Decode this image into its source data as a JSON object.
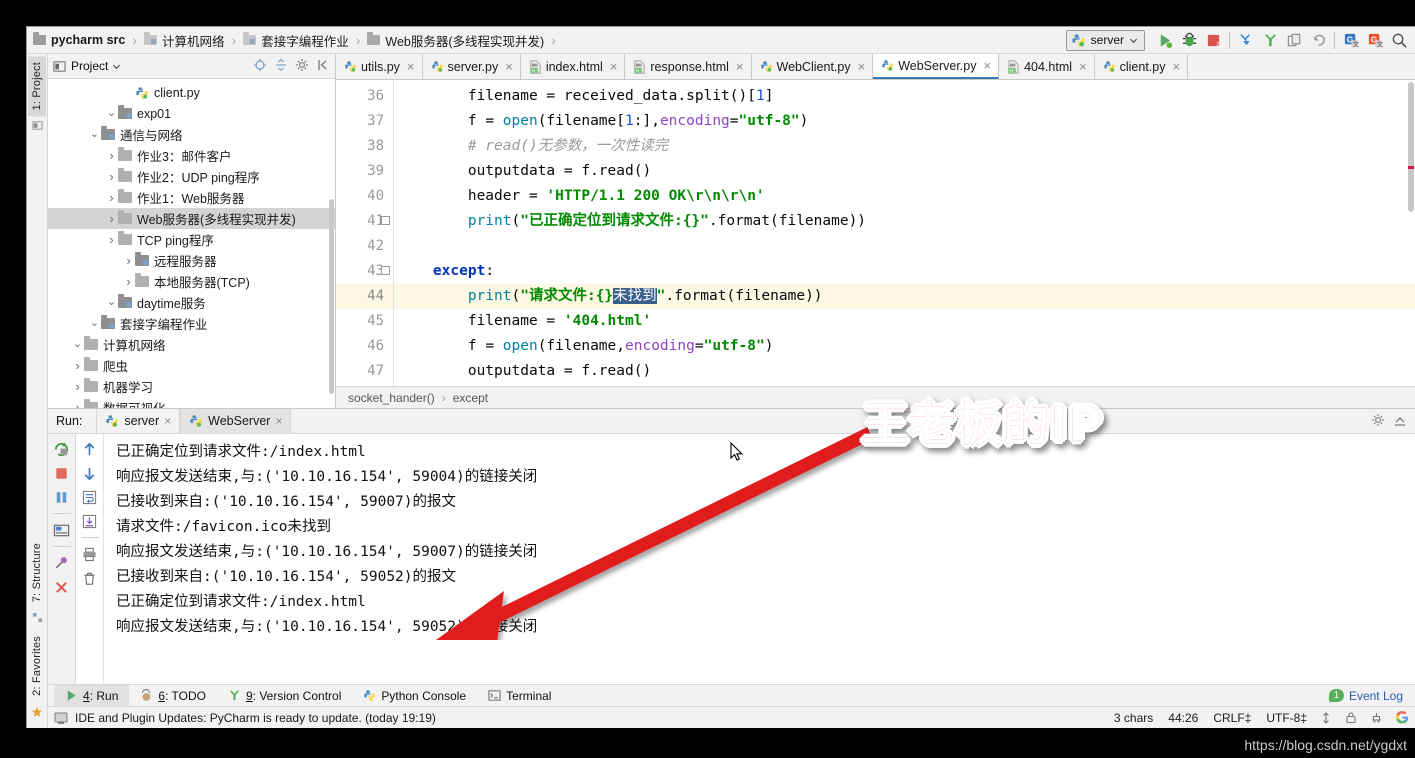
{
  "breadcrumb": [
    {
      "label": "pycharm src",
      "icon": "folder-icon",
      "bold": true
    },
    {
      "label": "计算机网络",
      "icon": "folder-icon",
      "bold": false
    },
    {
      "label": "套接字编程作业",
      "icon": "folder-icon",
      "bold": false
    },
    {
      "label": "Web服务器(多线程实现并发)",
      "icon": "folder-icon",
      "bold": false
    }
  ],
  "toolbar": {
    "run_config": "server",
    "run_config_icon": "python-config-icon",
    "dropdown_icon": "chevron-down-icon",
    "buttons": [
      {
        "name": "run-button",
        "icon": "play-icon"
      },
      {
        "name": "debug-button",
        "icon": "bug-icon"
      },
      {
        "name": "stop-button",
        "icon": "stop-icon"
      },
      {
        "name": "update-project-button",
        "icon": "vcs-update-icon"
      },
      {
        "name": "commit-button",
        "icon": "vcs-commit-icon"
      },
      {
        "name": "diff-button",
        "icon": "vcs-diff-icon"
      },
      {
        "name": "rollback-button",
        "icon": "undo-icon"
      },
      {
        "name": "translate-button",
        "icon": "translate-blue-icon"
      },
      {
        "name": "translate-back-button",
        "icon": "translate-red-icon"
      },
      {
        "name": "search-button",
        "icon": "search-icon"
      }
    ]
  },
  "rail": {
    "top": [
      {
        "label": "1: Project",
        "active": true
      }
    ],
    "bottom": [
      {
        "label": "7: Structure",
        "active": false
      },
      {
        "label": "2: Favorites",
        "active": false
      }
    ]
  },
  "project": {
    "title": "Project",
    "header_icons": [
      "collapse-target-icon",
      "collapse-all-icon",
      "gear-icon",
      "hide-icon"
    ],
    "tree": [
      {
        "label": "数据可视化",
        "depth": 1,
        "arrow": "›",
        "icon": "folder-icon",
        "type": "folder",
        "selected": false
      },
      {
        "label": "机器学习",
        "depth": 1,
        "arrow": "›",
        "icon": "folder-icon",
        "type": "folder",
        "selected": false
      },
      {
        "label": "爬虫",
        "depth": 1,
        "arrow": "›",
        "icon": "folder-icon",
        "type": "folder",
        "selected": false
      },
      {
        "label": "计算机网络",
        "depth": 1,
        "arrow": "⌄",
        "icon": "folder-icon",
        "type": "folder",
        "selected": false
      },
      {
        "label": "套接字编程作业",
        "depth": 2,
        "arrow": "⌄",
        "icon": "folder-module-icon",
        "type": "folder",
        "selected": false
      },
      {
        "label": "daytime服务",
        "depth": 3,
        "arrow": "⌄",
        "icon": "folder-module-icon",
        "type": "folder",
        "selected": false
      },
      {
        "label": "本地服务器(TCP)",
        "depth": 4,
        "arrow": "›",
        "icon": "folder-icon",
        "type": "folder",
        "selected": false
      },
      {
        "label": "远程服务器",
        "depth": 4,
        "arrow": "›",
        "icon": "folder-module-icon",
        "type": "folder",
        "selected": false
      },
      {
        "label": "TCP ping程序",
        "depth": 3,
        "arrow": "›",
        "icon": "folder-icon",
        "type": "folder",
        "selected": false
      },
      {
        "label": "Web服务器(多线程实现并发)",
        "depth": 3,
        "arrow": "›",
        "icon": "folder-icon",
        "type": "folder",
        "selected": true
      },
      {
        "label": "作业1：Web服务器",
        "depth": 3,
        "arrow": "›",
        "icon": "folder-icon",
        "type": "folder",
        "selected": false
      },
      {
        "label": "作业2：UDP ping程序",
        "depth": 3,
        "arrow": "›",
        "icon": "folder-icon",
        "type": "folder",
        "selected": false
      },
      {
        "label": "作业3：邮件客户",
        "depth": 3,
        "arrow": "›",
        "icon": "folder-icon",
        "type": "folder",
        "selected": false
      },
      {
        "label": "通信与网络",
        "depth": 2,
        "arrow": "⌄",
        "icon": "folder-module-icon",
        "type": "folder",
        "selected": false
      },
      {
        "label": "exp01",
        "depth": 3,
        "arrow": "⌄",
        "icon": "folder-module-icon",
        "type": "folder",
        "selected": false
      },
      {
        "label": "client.py",
        "depth": 4,
        "arrow": "",
        "icon": "python-file-icon",
        "type": "file",
        "selected": false
      }
    ]
  },
  "editor_tabs": [
    {
      "label": "utils.py",
      "icon": "python-file-icon",
      "active": false
    },
    {
      "label": "server.py",
      "icon": "python-file-icon",
      "active": false
    },
    {
      "label": "index.html",
      "icon": "html-file-icon",
      "active": false
    },
    {
      "label": "response.html",
      "icon": "html-file-icon",
      "active": false
    },
    {
      "label": "WebClient.py",
      "icon": "python-file-icon",
      "active": false
    },
    {
      "label": "WebServer.py",
      "icon": "python-file-icon",
      "active": true
    },
    {
      "label": "404.html",
      "icon": "html-file-icon",
      "active": false
    },
    {
      "label": "client.py",
      "icon": "python-file-icon",
      "active": false
    }
  ],
  "code": {
    "first_line": 36,
    "highlight_line": 44,
    "lines": [
      {
        "num": 36,
        "indent": 8,
        "tokens": [
          {
            "t": "filename ",
            "c": "plain"
          },
          {
            "t": "= ",
            "c": "plain"
          },
          {
            "t": "received_data",
            "c": "plain"
          },
          {
            "t": ".split()[",
            "c": "plain"
          },
          {
            "t": "1",
            "c": "num"
          },
          {
            "t": "]",
            "c": "plain"
          }
        ]
      },
      {
        "num": 37,
        "indent": 8,
        "tokens": [
          {
            "t": "f ",
            "c": "plain"
          },
          {
            "t": "= ",
            "c": "plain"
          },
          {
            "t": "open",
            "c": "fn"
          },
          {
            "t": "(filename[",
            "c": "plain"
          },
          {
            "t": "1",
            "c": "num"
          },
          {
            "t": ":],",
            "c": "plain"
          },
          {
            "t": "encoding",
            "c": "kwarg"
          },
          {
            "t": "=",
            "c": "plain"
          },
          {
            "t": "\"utf-8\"",
            "c": "str"
          },
          {
            "t": ")",
            "c": "plain"
          }
        ]
      },
      {
        "num": 38,
        "indent": 8,
        "tokens": [
          {
            "t": "# read()无参数，一次性读完",
            "c": "cmt"
          }
        ]
      },
      {
        "num": 39,
        "indent": 8,
        "tokens": [
          {
            "t": "outputdata ",
            "c": "plain"
          },
          {
            "t": "= ",
            "c": "plain"
          },
          {
            "t": "f.read()",
            "c": "plain"
          }
        ]
      },
      {
        "num": 40,
        "indent": 8,
        "tokens": [
          {
            "t": "header ",
            "c": "plain"
          },
          {
            "t": "= ",
            "c": "plain"
          },
          {
            "t": "'HTTP/1.1 200 OK\\r\\n\\r\\n'",
            "c": "str"
          }
        ]
      },
      {
        "num": 41,
        "indent": 8,
        "tokens": [
          {
            "t": "print",
            "c": "fn"
          },
          {
            "t": "(",
            "c": "plain"
          },
          {
            "t": "\"已正确定位到请求文件:{}\"",
            "c": "str"
          },
          {
            "t": ".format(filename))",
            "c": "plain"
          }
        ]
      },
      {
        "num": 42,
        "indent": 8,
        "tokens": []
      },
      {
        "num": 43,
        "indent": 4,
        "tokens": [
          {
            "t": "except",
            "c": "kw"
          },
          {
            "t": ":",
            "c": "plain"
          }
        ]
      },
      {
        "num": 44,
        "indent": 8,
        "tokens": [
          {
            "t": "print",
            "c": "fn"
          },
          {
            "t": "(",
            "c": "plain"
          },
          {
            "t": "\"请求文件:{}",
            "c": "str"
          },
          {
            "t": "未找到",
            "c": "sel-txt"
          },
          {
            "t": "\"",
            "c": "str"
          },
          {
            "t": ".format(filename))",
            "c": "plain"
          }
        ]
      },
      {
        "num": 45,
        "indent": 8,
        "tokens": [
          {
            "t": "filename ",
            "c": "plain"
          },
          {
            "t": "= ",
            "c": "plain"
          },
          {
            "t": "'404.html'",
            "c": "str"
          }
        ]
      },
      {
        "num": 46,
        "indent": 8,
        "tokens": [
          {
            "t": "f ",
            "c": "plain"
          },
          {
            "t": "= ",
            "c": "plain"
          },
          {
            "t": "open",
            "c": "fn"
          },
          {
            "t": "(filename,",
            "c": "plain"
          },
          {
            "t": "encoding",
            "c": "kwarg"
          },
          {
            "t": "=",
            "c": "plain"
          },
          {
            "t": "\"utf-8\"",
            "c": "str"
          },
          {
            "t": ")",
            "c": "plain"
          }
        ]
      },
      {
        "num": 47,
        "indent": 8,
        "tokens": [
          {
            "t": "outputdata ",
            "c": "plain"
          },
          {
            "t": "= ",
            "c": "plain"
          },
          {
            "t": "f.read()",
            "c": "plain"
          }
        ]
      }
    ]
  },
  "editor_breadcrumb": [
    "socket_hander()",
    "except"
  ],
  "run_panel": {
    "label": "Run:",
    "tabs": [
      {
        "label": "server",
        "icon": "python-config-icon",
        "active": false
      },
      {
        "label": "WebServer",
        "icon": "python-config-icon",
        "active": true
      }
    ],
    "header_icons": [
      "gear-icon",
      "hide-icon"
    ],
    "tools": [
      {
        "name": "rerun-button",
        "icon": "rerun-icon"
      },
      {
        "name": "stop-button",
        "icon": "stop-square-icon"
      },
      {
        "name": "pause-button",
        "icon": "pause-icon"
      },
      {
        "name": "console-view-button",
        "icon": "console-icon"
      },
      {
        "name": "pin-button",
        "icon": "pin-icon"
      },
      {
        "name": "close-button",
        "icon": "close-x-icon"
      }
    ],
    "gutter_tools": [
      {
        "name": "scroll-up-button",
        "icon": "arrow-up-icon"
      },
      {
        "name": "scroll-down-button",
        "icon": "arrow-down-icon"
      },
      {
        "name": "soft-wrap-button",
        "icon": "soft-wrap-icon"
      },
      {
        "name": "scroll-to-end-button",
        "icon": "scroll-end-icon"
      },
      {
        "name": "print-button",
        "icon": "printer-icon"
      },
      {
        "name": "clear-all-button",
        "icon": "trash-icon"
      }
    ],
    "output": [
      "已正确定位到请求文件:/index.html",
      "响应报文发送结束,与:('10.10.16.154', 59004)的链接关闭",
      "已接收到来自:('10.10.16.154', 59007)的报文",
      "请求文件:/favicon.ico未找到",
      "响应报文发送结束,与:('10.10.16.154', 59007)的链接关闭",
      "已接收到来自:('10.10.16.154', 59052)的报文",
      "已正确定位到请求文件:/index.html",
      "响应报文发送结束,与:('10.10.16.154', 59052)的链接关闭"
    ]
  },
  "bottom_tabs": [
    {
      "num": "4",
      "label": ": Run",
      "icon": "play-green-icon",
      "active": true
    },
    {
      "num": "6",
      "label": ": TODO",
      "icon": "todo-icon",
      "active": false
    },
    {
      "num": "9",
      "label": ": Version Control",
      "icon": "vcs-branch-icon",
      "active": false
    },
    {
      "num": "",
      "label": "Python Console",
      "icon": "python-icon",
      "active": false
    },
    {
      "num": "",
      "label": "Terminal",
      "icon": "terminal-icon",
      "active": false
    }
  ],
  "event_log": {
    "label": "Event Log",
    "count": "1"
  },
  "status": {
    "message": "IDE and Plugin Updates: PyCharm is ready to update. (today 19:19)",
    "message_icon": "ide-update-icon",
    "chars": "3 chars",
    "caret": "44:26",
    "line_sep": "CRLF‡",
    "encoding": "UTF-8‡",
    "icons": [
      "indent-icon",
      "lock-icon",
      "inspection-icon",
      "google-icon"
    ]
  },
  "annotation": {
    "text": "王老板的IP",
    "color": "#e00d0d",
    "arrow_color": "#e01b1b"
  },
  "watermark": "https://blog.csdn.net/ygdxt"
}
